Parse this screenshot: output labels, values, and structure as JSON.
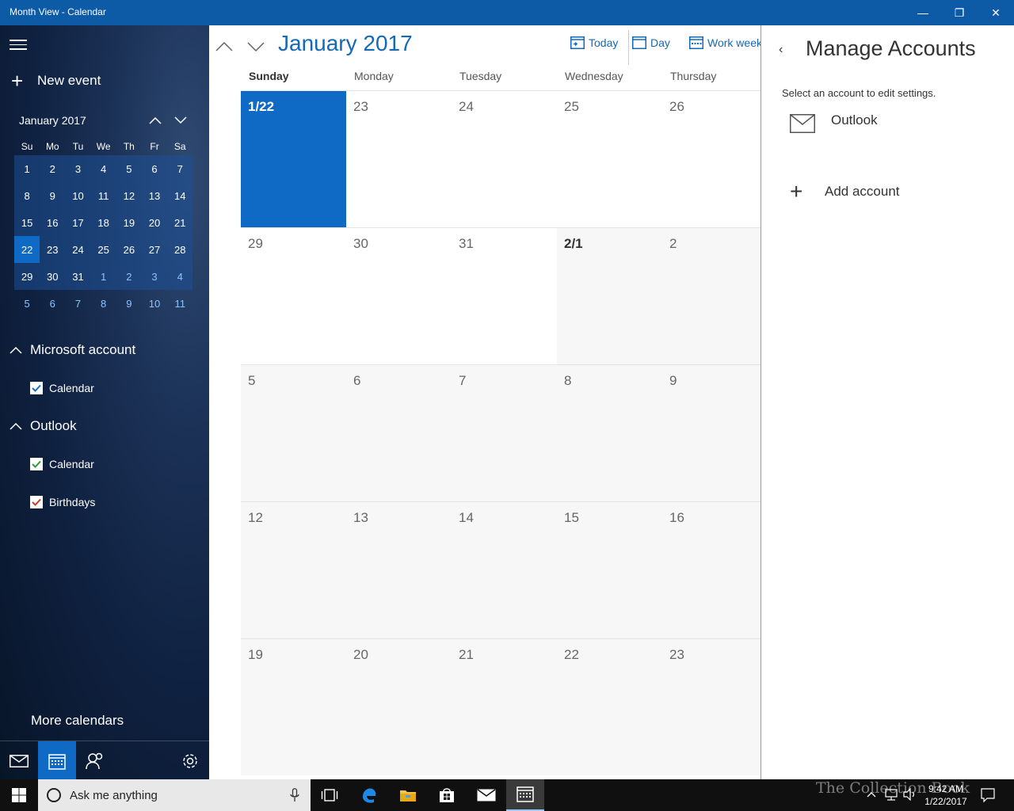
{
  "window": {
    "title": "Month View - Calendar",
    "minimize_glyph": "—",
    "restore_glyph": "❐",
    "close_glyph": "✕"
  },
  "sidebar": {
    "new_event_label": "New event",
    "mini_calendar": {
      "title": "January 2017",
      "weekdays": [
        "Su",
        "Mo",
        "Tu",
        "We",
        "Th",
        "Fr",
        "Sa"
      ],
      "weeks": [
        [
          "1",
          "2",
          "3",
          "4",
          "5",
          "6",
          "7"
        ],
        [
          "8",
          "9",
          "10",
          "11",
          "12",
          "13",
          "14"
        ],
        [
          "15",
          "16",
          "17",
          "18",
          "19",
          "20",
          "21"
        ],
        [
          "22",
          "23",
          "24",
          "25",
          "26",
          "27",
          "28"
        ],
        [
          "29",
          "30",
          "31",
          "1",
          "2",
          "3",
          "4"
        ],
        [
          "5",
          "6",
          "7",
          "8",
          "9",
          "10",
          "11"
        ]
      ]
    },
    "groups": [
      {
        "name": "Microsoft account",
        "calendars": [
          {
            "label": "Calendar",
            "color": "#1a6fd1",
            "checked": true
          }
        ]
      },
      {
        "name": "Outlook",
        "calendars": [
          {
            "label": "Calendar",
            "color": "#2e9a3e",
            "checked": true
          },
          {
            "label": "Birthdays",
            "color": "#d83a2a",
            "checked": true
          }
        ]
      }
    ],
    "more_calendars_label": "More calendars",
    "bottom_icons": [
      "mail-icon",
      "calendar-icon",
      "people-icon",
      "gear-icon"
    ]
  },
  "main": {
    "month_title": "January 2017",
    "toolbar": {
      "today_label": "Today",
      "day_label": "Day",
      "work_week_label": "Work week"
    },
    "weekdays": [
      "Sunday",
      "Monday",
      "Tuesday",
      "Wednesday",
      "Thursday"
    ],
    "weeks": [
      [
        "1/22",
        "23",
        "24",
        "25",
        "26"
      ],
      [
        "29",
        "30",
        "31",
        "2/1",
        "2"
      ],
      [
        "5",
        "6",
        "7",
        "8",
        "9"
      ],
      [
        "12",
        "13",
        "14",
        "15",
        "16"
      ],
      [
        "19",
        "20",
        "21",
        "22",
        "23"
      ]
    ]
  },
  "panel": {
    "back_glyph": "‹",
    "title": "Manage Accounts",
    "subtitle": "Select an account to edit settings.",
    "account_name": "Outlook",
    "add_account_label": "Add account"
  },
  "taskbar": {
    "search_placeholder": "Ask me anything",
    "time": "9:42 AM",
    "date": "1/22/2017",
    "watermark": "The Collection Book"
  },
  "colors": {
    "accent": "#0e6ac4",
    "titlebar": "#0d5aa7",
    "link": "#1469b8"
  }
}
